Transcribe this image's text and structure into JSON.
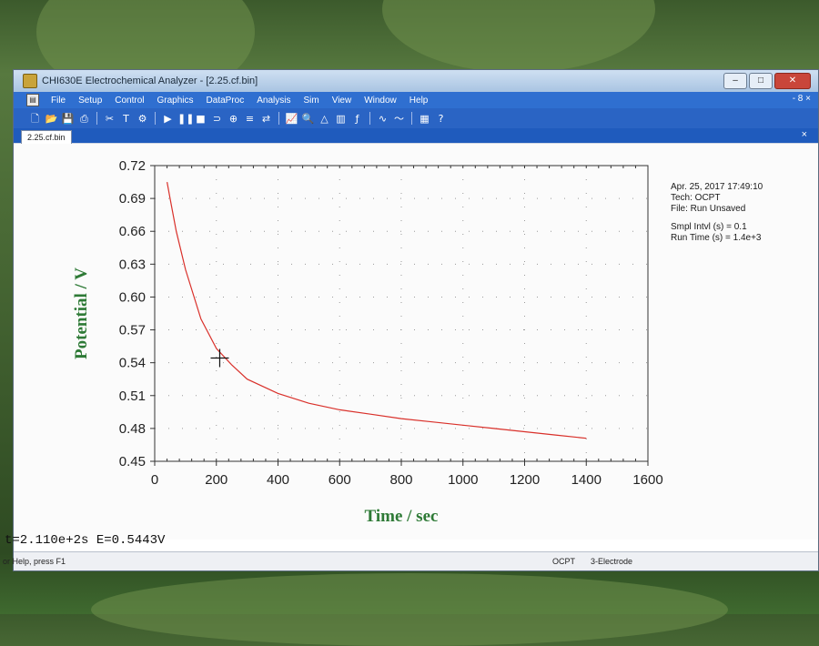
{
  "window": {
    "title": "CHI630E Electrochemical Analyzer - [2.25.cf.bin]",
    "controls": {
      "minimize": "–",
      "maximize": "□",
      "close": "✕"
    }
  },
  "menu": {
    "items": [
      "File",
      "Setup",
      "Control",
      "Graphics",
      "DataProc",
      "Analysis",
      "Sim",
      "View",
      "Window",
      "Help"
    ],
    "right_controls": "- 8 ×"
  },
  "toolbar_icons": [
    "new-file",
    "open-file",
    "save",
    "print",
    "sep",
    "text",
    "tool",
    "sep",
    "run",
    "pause",
    "stop",
    "reverse",
    "zoom-to-fit",
    "data-list",
    "sep",
    "graph",
    "magnify",
    "peak",
    "sep",
    "color",
    "fp",
    "sep",
    "wave",
    "sep",
    "table",
    "help"
  ],
  "doc_tab": {
    "label": "2.25.cf.bin",
    "close": "×"
  },
  "info_panel": {
    "date_time": "Apr. 25, 2017   17:49:10",
    "tech": "Tech: OCPT",
    "file": "File: Run Unsaved",
    "sample_interval": "Smpl Intvl (s) = 0.1",
    "run_time": "Run Time (s) = 1.4e+3"
  },
  "readout": "t=2.110e+2s   E=0.5443V",
  "status_bar": {
    "help": "or Help, press F1",
    "tech": "OCPT",
    "electrode": "3-Electrode"
  },
  "chart_data": {
    "type": "line",
    "xlabel": "Time / sec",
    "ylabel": "Potential / V",
    "xlim": [
      0,
      1600
    ],
    "ylim": [
      0.45,
      0.72
    ],
    "xticks": [
      0,
      200,
      400,
      600,
      800,
      1000,
      1200,
      1400,
      1600
    ],
    "yticks": [
      0.72,
      0.69,
      0.66,
      0.63,
      0.6,
      0.57,
      0.54,
      0.51,
      0.48,
      0.45
    ],
    "ytick_labels": [
      "0.72",
      "0.69",
      "0.66",
      "0.63",
      "0.60",
      "0.57",
      "0.54",
      "0.51",
      "0.48",
      "0.45"
    ],
    "grid": "dotted",
    "line_color": "#d9302a",
    "series": [
      {
        "x": [
          40,
          50,
          70,
          100,
          150,
          200,
          250,
          300,
          400,
          500,
          600,
          700,
          800,
          900,
          1000,
          1100,
          1200,
          1300,
          1400
        ],
        "y": [
          0.705,
          0.69,
          0.66,
          0.625,
          0.58,
          0.553,
          0.538,
          0.525,
          0.512,
          0.503,
          0.497,
          0.493,
          0.489,
          0.486,
          0.483,
          0.48,
          0.477,
          0.474,
          0.471
        ]
      }
    ],
    "cursor": {
      "x": 211,
      "y": 0.5443
    }
  }
}
